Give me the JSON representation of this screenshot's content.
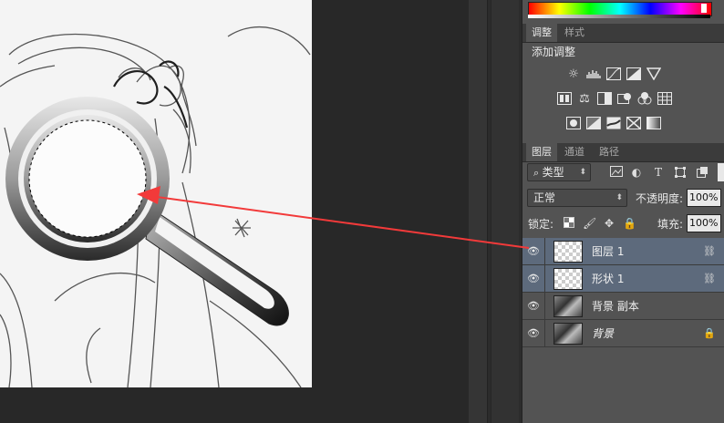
{
  "colors": {
    "workspace": "#282828",
    "panel": "#535353",
    "selected_layer": "#5d6a7c",
    "arrow": "#f23a3a"
  },
  "adjust_panel": {
    "tabs": [
      {
        "label": "调整",
        "active": true
      },
      {
        "label": "样式",
        "active": false
      }
    ],
    "title": "添加调整",
    "icons_row1": [
      "brightness-icon",
      "levels-icon",
      "curves-icon",
      "exposure-icon",
      "vibrance-icon"
    ],
    "icons_row2": [
      "hue-saturation-icon",
      "color-balance-icon",
      "black-white-icon",
      "photo-filter-icon",
      "channel-mixer-icon",
      "color-lookup-icon"
    ],
    "icons_row3": [
      "invert-icon",
      "posterize-icon",
      "threshold-icon",
      "selective-color-icon",
      "gradient-map-icon"
    ]
  },
  "layers_panel": {
    "tabs": [
      {
        "label": "图层",
        "active": true
      },
      {
        "label": "通道",
        "active": false
      },
      {
        "label": "路径",
        "active": false
      }
    ],
    "filter": {
      "label": "类型"
    },
    "blend_mode": "正常",
    "opacity_label": "不透明度:",
    "opacity_value": "100%",
    "lock_label": "锁定:",
    "fill_label": "填充:",
    "fill_value": "100%",
    "layers": [
      {
        "name": "图层 1",
        "thumb": "transparent",
        "selected": true,
        "linked": true,
        "locked": false,
        "italic": false
      },
      {
        "name": "形状 1",
        "thumb": "transparent",
        "selected": true,
        "linked": true,
        "locked": false,
        "italic": false
      },
      {
        "name": "背景 副本",
        "thumb": "photo",
        "selected": false,
        "linked": false,
        "locked": false,
        "italic": false
      },
      {
        "name": "背景",
        "thumb": "photo",
        "selected": false,
        "linked": false,
        "locked": true,
        "italic": true
      }
    ]
  }
}
